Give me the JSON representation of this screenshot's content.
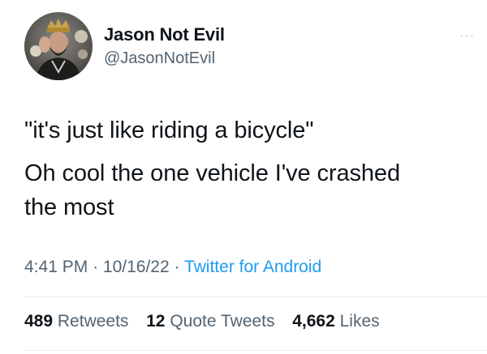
{
  "user": {
    "display_name": "Jason Not Evil",
    "handle": "@JasonNotEvil"
  },
  "more_menu": "···",
  "tweet": {
    "line1": "\"it's just like riding a bicycle\"",
    "line2": "Oh cool the one vehicle I've crashed",
    "line3": "the most"
  },
  "meta": {
    "time": "4:41 PM",
    "separator1": "·",
    "date": "10/16/22",
    "separator2": "·",
    "source": "Twitter for Android"
  },
  "stats": {
    "retweets_count": "489",
    "retweets_label": "Retweets",
    "quotes_count": "12",
    "quotes_label": "Quote Tweets",
    "likes_count": "4,662",
    "likes_label": "Likes"
  },
  "colors": {
    "text": "#0f1419",
    "secondary": "#536471",
    "link": "#1d9bf0",
    "divider": "#e6ecf0"
  },
  "icons": {
    "avatar": "user-avatar",
    "more": "more-horizontal-icon"
  }
}
